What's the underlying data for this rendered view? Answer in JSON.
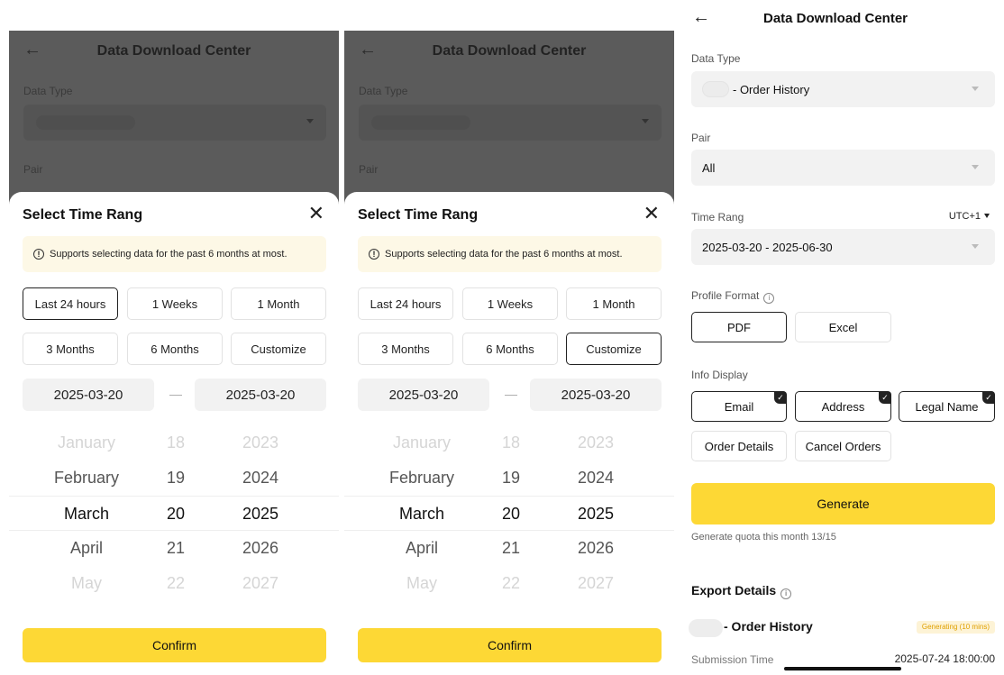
{
  "header": {
    "back_glyph": "←",
    "title": "Data Download Center"
  },
  "background": {
    "data_type_label": "Data Type",
    "pair_label": "Pair"
  },
  "sheet": {
    "title": "Select Time Rang",
    "close_glyph": "✕",
    "notice_icon": "!",
    "notice": "Supports selecting data for the past 6 months at most.",
    "presets": [
      "Last 24 hours",
      "1 Weeks",
      "1 Month",
      "3 Months",
      "6 Months",
      "Customize"
    ],
    "start_date": "2025-03-20",
    "end_date": "2025-03-20",
    "dash": "—",
    "picker": {
      "months": [
        "January",
        "February",
        "March",
        "April",
        "May"
      ],
      "days": [
        "18",
        "19",
        "20",
        "21",
        "22"
      ],
      "years": [
        "2023",
        "2024",
        "2025",
        "2026",
        "2027"
      ]
    },
    "confirm": "Confirm"
  },
  "panel1": {
    "selected_preset": "Last 24 hours"
  },
  "panel2": {
    "selected_preset": "Customize"
  },
  "center": {
    "data_type_label": "Data Type",
    "data_type_value": "- Order History",
    "pair_label": "Pair",
    "pair_value": "All",
    "time_label": "Time Rang",
    "timezone": "UTC+1",
    "time_value": "2025-03-20 - 2025-06-30",
    "format_label": "Profile Format",
    "info_icon": "i",
    "formats": [
      "PDF",
      "Excel"
    ],
    "selected_format": "PDF",
    "info_label": "Info Display",
    "info_options": [
      "Email",
      "Address",
      "Legal Name",
      "Order Details",
      "Cancel Orders"
    ],
    "info_selected": [
      "Email",
      "Address",
      "Legal Name"
    ],
    "check_glyph": "✓",
    "generate": "Generate",
    "quota": "Generate quota this month 13/15",
    "export_title": "Export Details",
    "export_name": "- Order History",
    "export_status": "Generating (10 mins)",
    "submission_label": "Submission Time",
    "submission_value": "2025-07-24 18:00:00"
  },
  "colors": {
    "accent": "#fdd835",
    "overlay": "#5b5b5b",
    "notice_bg": "#fdf8e6",
    "status_text": "#e0a000"
  }
}
